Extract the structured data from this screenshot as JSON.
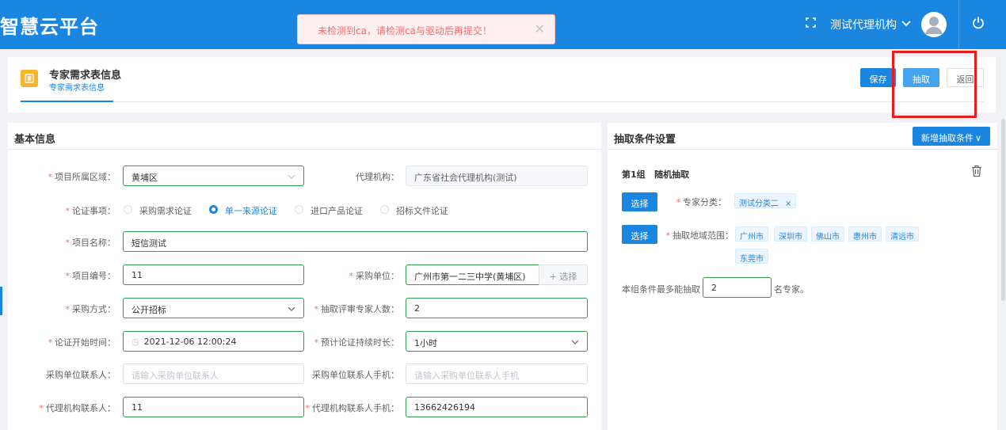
{
  "app": {
    "brand": "智慧云平台"
  },
  "toast": {
    "message": "未检测到ca，请检测ca与驱动后再提交！",
    "close": "✕"
  },
  "topbar": {
    "fullscreen_icon": "fullscreen-icon",
    "org_name": "测试代理机构",
    "caret_icon": "chevron-down-icon",
    "power_icon": "power-icon"
  },
  "page_header": {
    "title": "专家需求表信息",
    "tab": "专家需求表信息"
  },
  "actions": {
    "save": "保存",
    "extract": "抽取",
    "back": "返回"
  },
  "basic": {
    "title": "基本信息",
    "region": {
      "label": "项目所属区域：",
      "value": "黄埔区"
    },
    "agency": {
      "label": "代理机构：",
      "value": "广东省社会代理机构(测试)"
    },
    "matter": {
      "label": "论证事项：",
      "options": [
        "采购需求论证",
        "单一来源论证",
        "进口产品论证",
        "招标文件论证"
      ],
      "selected": "单一来源论证"
    },
    "project_name": {
      "label": "项目名称：",
      "value": "短信测试"
    },
    "project_no": {
      "label": "项目编号：",
      "value": "11"
    },
    "buyer": {
      "label": "采购单位：",
      "value": "广州市第一二三中学(黄埔区)",
      "select_btn": "+ 选择"
    },
    "method": {
      "label": "采购方式：",
      "value": "公开招标"
    },
    "expert_count": {
      "label": "抽取评审专家人数：",
      "value": "2"
    },
    "start_time": {
      "label": "论证开始时间：",
      "value": "2021-12-06 12:00:24"
    },
    "duration": {
      "label": "预计论证持续时长：",
      "value": "1小时"
    },
    "buyer_contact": {
      "label": "采购单位联系人：",
      "placeholder": "请输入采购单位联系人"
    },
    "buyer_phone": {
      "label": "采购单位联系人手机：",
      "placeholder": "请输入采购单位联系人手机"
    },
    "agent_contact": {
      "label": "代理机构联系人：",
      "value": "11"
    },
    "agent_phone": {
      "label": "代理机构联系人手机：",
      "value": "13662426194"
    }
  },
  "conditions": {
    "title": "抽取条件设置",
    "add_btn": "新增抽取条件",
    "group_title": "第1组   随机抽取",
    "select_btn": "选择",
    "category_label": "专家分类：",
    "category_tag": "测试分类二",
    "area_label": "抽取地域范围：",
    "areas": [
      "广州市",
      "深圳市",
      "佛山市",
      "惠州市",
      "清远市",
      "东莞市"
    ],
    "max_prefix": "本组条件最多能抽取",
    "max_value": "2",
    "max_suffix": "名专家。"
  },
  "colors": {
    "primary": "#1b86e0",
    "success_border": "#2e9e4c",
    "danger": "#f56c6c",
    "highlight": "#e81c1c"
  }
}
